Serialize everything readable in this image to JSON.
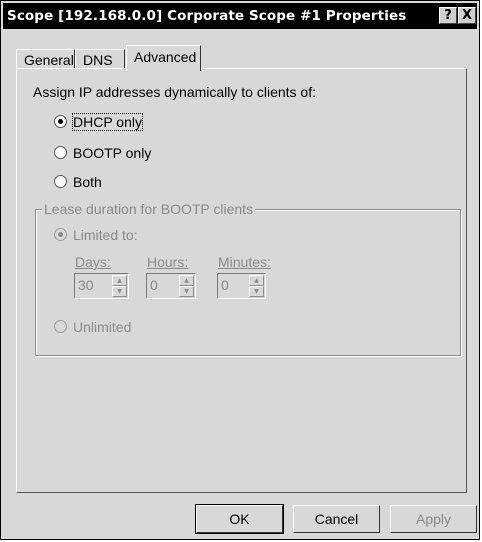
{
  "window": {
    "title": "Scope [192.168.0.0] Corporate Scope #1 Properties",
    "help_button": "?",
    "close_button": "X"
  },
  "tabs": [
    {
      "label": "General",
      "active": false
    },
    {
      "label": "DNS",
      "active": false
    },
    {
      "label": "Advanced",
      "active": true
    }
  ],
  "assign_label": "Assign IP addresses dynamically to clients of:",
  "client_options": [
    {
      "label": "DHCP only",
      "selected": true
    },
    {
      "label": "BOOTP only",
      "selected": false
    },
    {
      "label": "Both",
      "selected": false
    }
  ],
  "lease": {
    "group_label": "Lease duration for BOOTP clients",
    "limited_label": "Limited to:",
    "limited_selected": true,
    "days_label": "Days:",
    "days_value": "30",
    "hours_label": "Hours:",
    "hours_value": "0",
    "minutes_label": "Minutes:",
    "minutes_value": "0",
    "unlimited_label": "Unlimited",
    "enabled": false
  },
  "buttons": {
    "ok": "OK",
    "cancel": "Cancel",
    "apply": "Apply"
  },
  "colors": {
    "dialog_bg": "#d8d8d8",
    "titlebar_bg": "#000000",
    "disabled_text": "#8a8a8a"
  }
}
